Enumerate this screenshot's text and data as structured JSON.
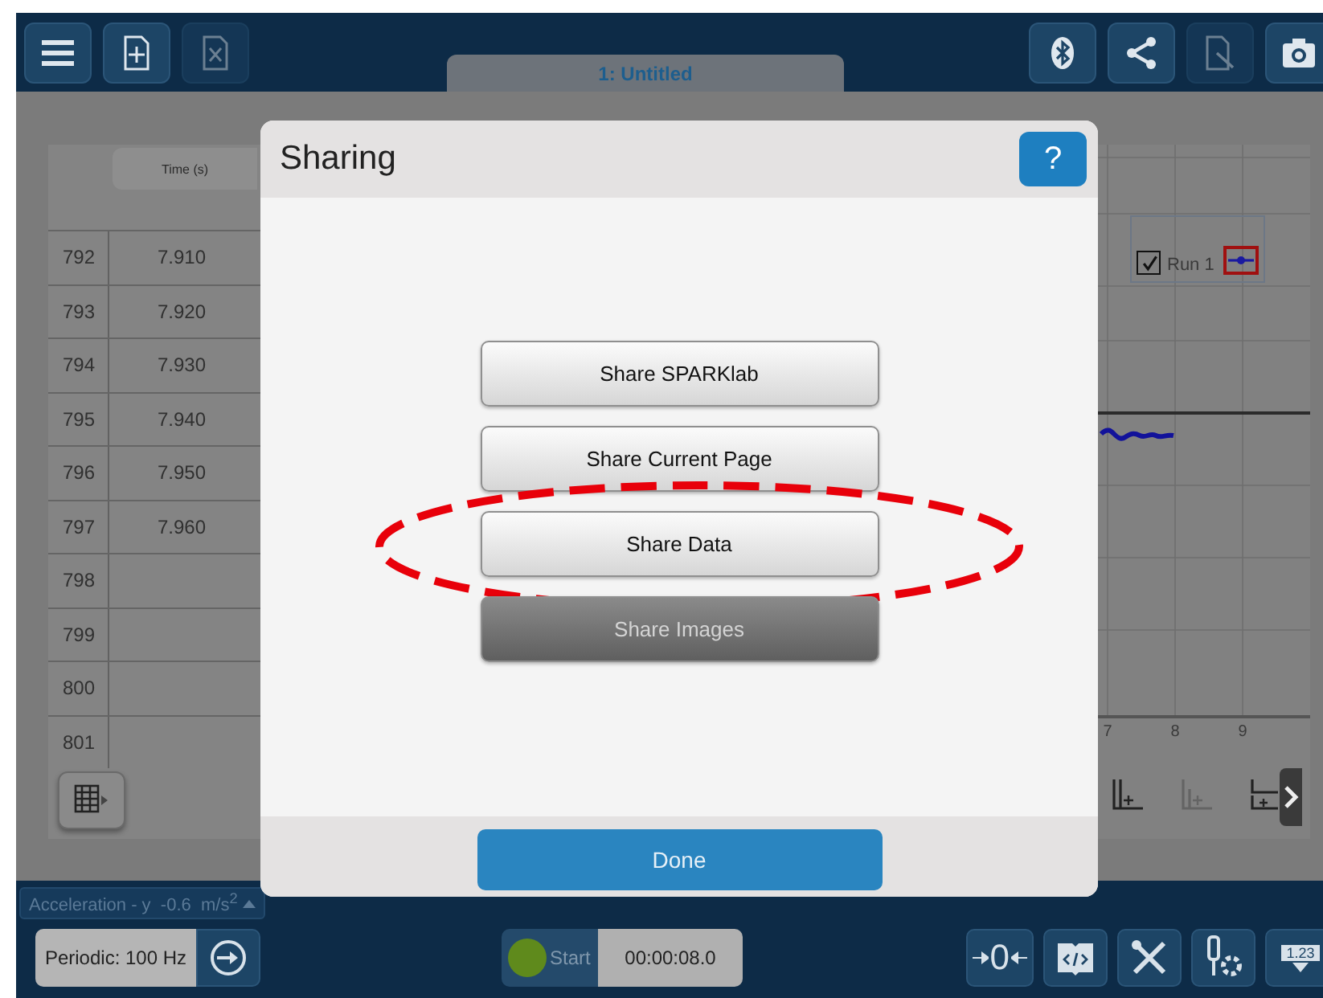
{
  "toolbar": {
    "left": [
      {
        "kind": "menu",
        "disabled": false
      },
      {
        "kind": "new-page",
        "disabled": false
      },
      {
        "kind": "delete-page",
        "disabled": true
      }
    ],
    "right": [
      {
        "kind": "bluetooth",
        "disabled": false
      },
      {
        "kind": "share",
        "disabled": false
      },
      {
        "kind": "export",
        "disabled": true
      },
      {
        "kind": "camera",
        "disabled": false
      }
    ]
  },
  "document_tab": {
    "title": "1: Untitled"
  },
  "table": {
    "columns": [
      "Time (s)"
    ],
    "rows": [
      {
        "index": "792",
        "time": "7.910"
      },
      {
        "index": "793",
        "time": "7.920"
      },
      {
        "index": "794",
        "time": "7.930"
      },
      {
        "index": "795",
        "time": "7.940"
      },
      {
        "index": "796",
        "time": "7.950"
      },
      {
        "index": "797",
        "time": "7.960"
      },
      {
        "index": "798"
      },
      {
        "index": "799"
      },
      {
        "index": "800"
      },
      {
        "index": "801"
      }
    ]
  },
  "graph": {
    "legend": [
      {
        "label": "Run 1",
        "checked": true
      }
    ],
    "x_ticks": [
      "7",
      "8",
      "9"
    ],
    "tools": [
      {
        "kind": "add-axis",
        "disabled": false
      },
      {
        "kind": "add-plot",
        "disabled": true
      },
      {
        "kind": "add-graph",
        "disabled": false
      }
    ]
  },
  "dialog": {
    "title": "Sharing",
    "help_label": "?",
    "buttons": [
      {
        "label": "Share SPARKlab",
        "disabled": false,
        "highlighted": false
      },
      {
        "label": "Share Current Page",
        "disabled": false,
        "highlighted": false
      },
      {
        "label": "Share Data",
        "disabled": false,
        "highlighted": true
      },
      {
        "label": "Share Images",
        "disabled": true,
        "highlighted": false
      }
    ],
    "done_label": "Done"
  },
  "sensor_readout": "Acceleration - y  -0.6  m/s$^{2}$",
  "bottom_bar": {
    "sample_rate": "Periodic: 100 Hz",
    "start_label": "Start",
    "elapsed": "00:00:08.0",
    "zero_label": "0",
    "meter_label": "1.23"
  }
}
